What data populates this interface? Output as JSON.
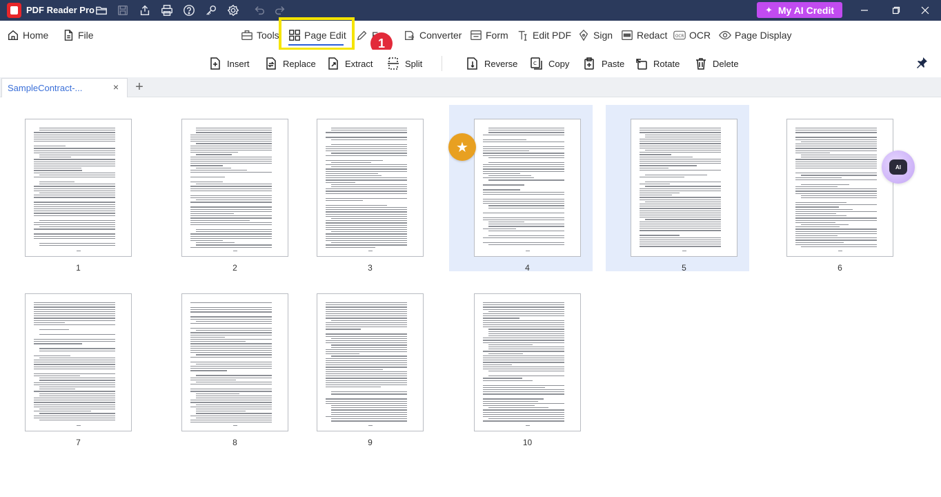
{
  "app": {
    "title": "PDF Reader Pro",
    "ai_credit_label": "My AI Credit"
  },
  "titlebar_icons": [
    "folder-open-icon",
    "save-icon",
    "share-icon",
    "print-icon",
    "help-icon",
    "key-icon",
    "settings-icon",
    "undo-icon",
    "redo-icon"
  ],
  "toolbar": {
    "home": "Home",
    "file": "File",
    "tools": "Tools",
    "page_edit": "Page Edit",
    "edit_partial": "E",
    "converter": "Converter",
    "form": "Form",
    "edit_pdf": "Edit PDF",
    "sign": "Sign",
    "redact": "Redact",
    "ocr": "OCR",
    "page_display": "Page Display"
  },
  "callout_number": "1",
  "subtoolbar": {
    "insert": "Insert",
    "replace": "Replace",
    "extract": "Extract",
    "split": "Split",
    "reverse": "Reverse",
    "copy": "Copy",
    "paste": "Paste",
    "rotate": "Rotate",
    "delete": "Delete"
  },
  "tab": {
    "label": "SampleContract-...",
    "close": "×",
    "add": "+"
  },
  "pages": [
    {
      "num": "1",
      "selected": false
    },
    {
      "num": "2",
      "selected": false
    },
    {
      "num": "3",
      "selected": false
    },
    {
      "num": "4",
      "selected": true
    },
    {
      "num": "5",
      "selected": true
    },
    {
      "num": "6",
      "selected": false
    },
    {
      "num": "7",
      "selected": false
    },
    {
      "num": "8",
      "selected": false
    },
    {
      "num": "9",
      "selected": false
    },
    {
      "num": "10",
      "selected": false
    }
  ],
  "ai_bot_label": "AI",
  "colors": {
    "titlebar": "#2b3a5c",
    "ai_credit": "#c14bf0",
    "highlight": "#f5e400",
    "badge": "#e22a3a",
    "selection": "#e4ecfb",
    "star": "#e8a021"
  }
}
